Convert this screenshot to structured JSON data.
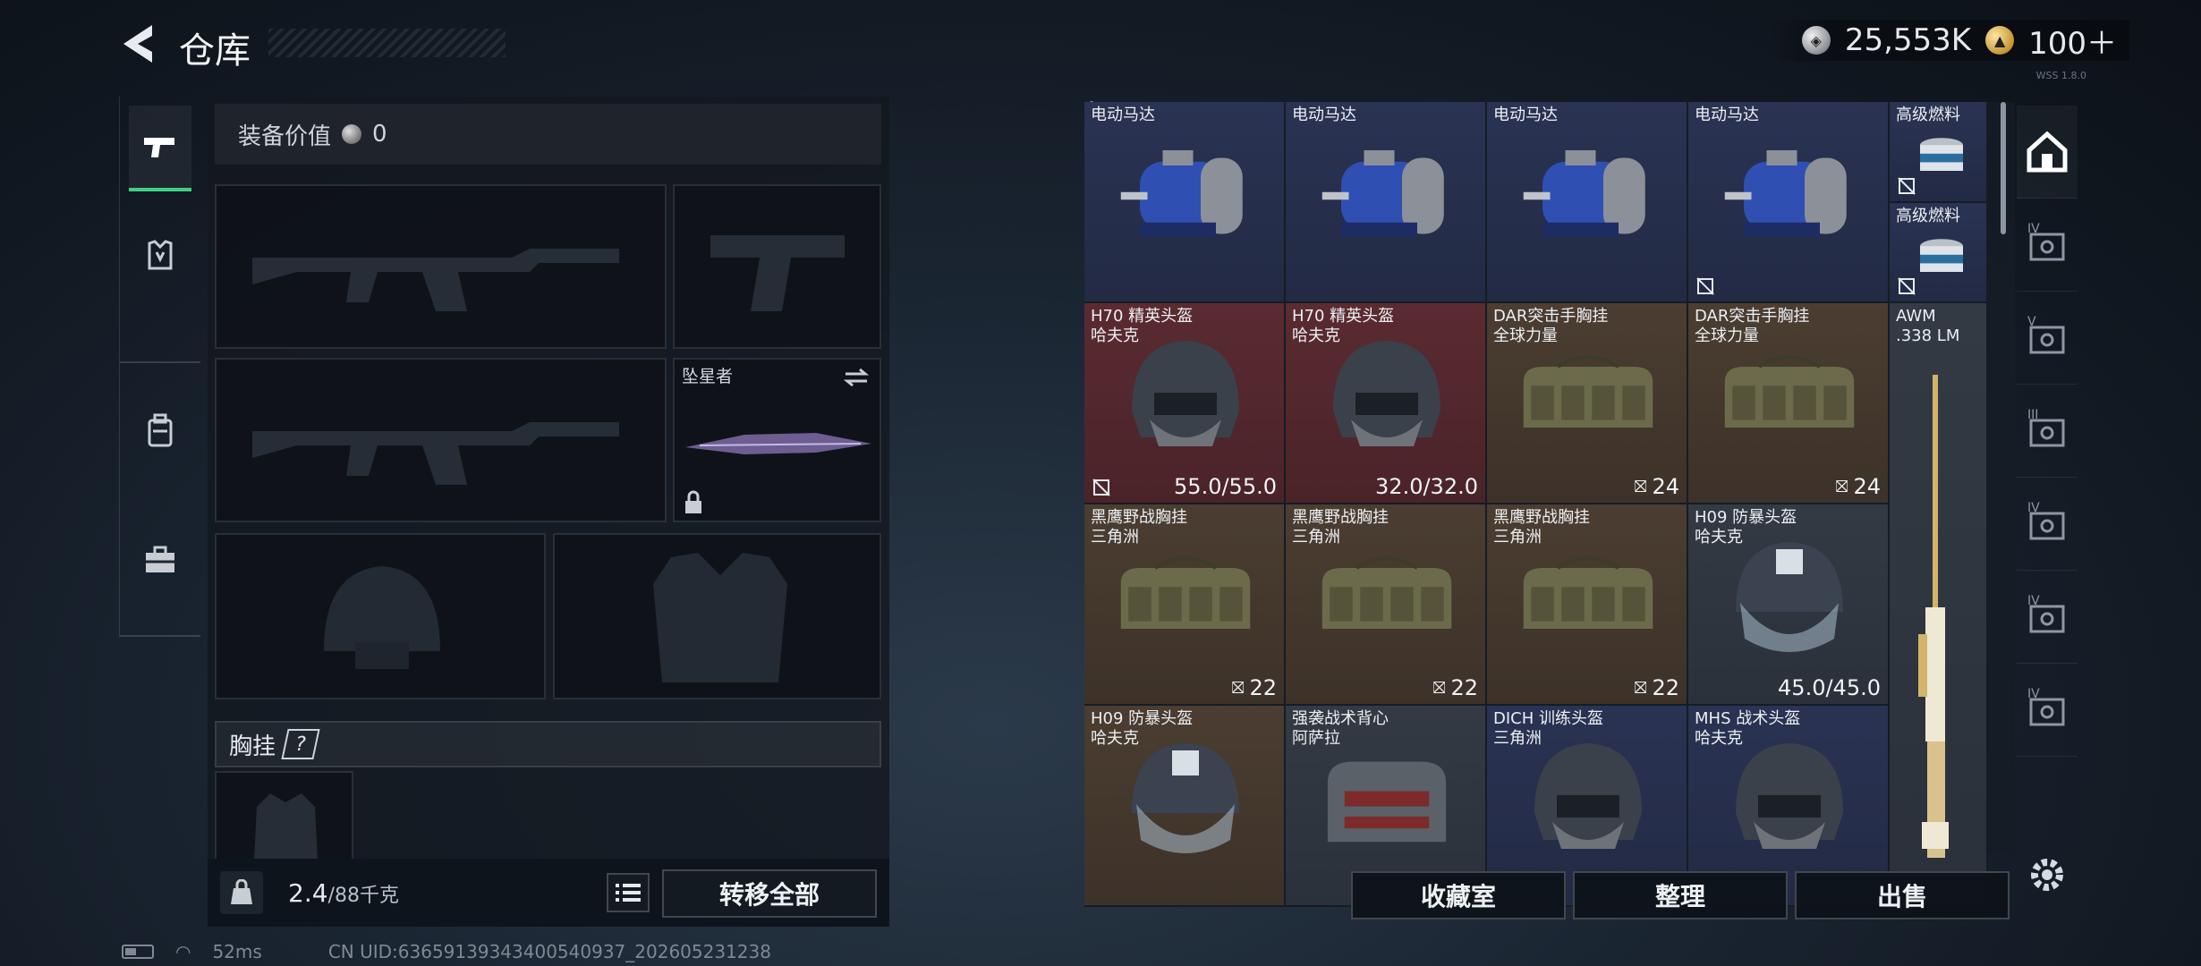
{
  "header": {
    "title": "仓库",
    "currency_silver": "25,553K",
    "currency_gold": "100＋",
    "corner_text": "WSS 1.8.0"
  },
  "equipment": {
    "value_label": "装备价值",
    "value": "0",
    "melee_name": "坠星者",
    "chest_rig_label": "胸挂",
    "help_symbol": "?",
    "weight": "2.4",
    "weight_max": "/88千克",
    "transfer_all": "转移全部"
  },
  "inventory": {
    "cells": [
      {
        "name": "电动马达",
        "sub": "",
        "value": "",
        "color": "blue",
        "icon": "electric-motor",
        "lock": false
      },
      {
        "name": "电动马达",
        "sub": "",
        "value": "",
        "color": "blue",
        "icon": "electric-motor",
        "lock": false
      },
      {
        "name": "电动马达",
        "sub": "",
        "value": "",
        "color": "blue",
        "icon": "electric-motor",
        "lock": false
      },
      {
        "name": "电动马达",
        "sub": "",
        "value": "",
        "color": "blue",
        "icon": "electric-motor",
        "lock": true
      },
      {
        "name": "高级燃料",
        "sub": "",
        "value": "",
        "color": "blue",
        "icon": "fuel-can",
        "lock": true
      },
      {
        "name": "高级燃料",
        "sub": "",
        "value": "",
        "color": "blue",
        "icon": "fuel-can",
        "lock": true
      },
      {
        "name": "H70 精英头盔",
        "sub": "哈夫克",
        "value": "55.0/55.0",
        "color": "red",
        "icon": "helmet",
        "lock": true
      },
      {
        "name": "H70 精英头盔",
        "sub": "哈夫克",
        "value": "32.0/32.0",
        "color": "red",
        "icon": "helmet",
        "lock": false
      },
      {
        "name": "DAR突击手胸挂",
        "sub": "全球力量",
        "value": "24",
        "color": "brown",
        "icon": "chest-rig",
        "lock": false
      },
      {
        "name": "DAR突击手胸挂",
        "sub": "全球力量",
        "value": "24",
        "color": "brown",
        "icon": "chest-rig",
        "lock": false
      },
      {
        "name": "AWM",
        "sub": ".338 LM",
        "value": "",
        "color": "gray",
        "icon": "sniper-rifle",
        "lock": false
      },
      {
        "name": "黑鹰野战胸挂",
        "sub": "三角洲",
        "value": "22",
        "color": "brown",
        "icon": "chest-rig",
        "lock": false
      },
      {
        "name": "黑鹰野战胸挂",
        "sub": "三角洲",
        "value": "22",
        "color": "brown",
        "icon": "chest-rig",
        "lock": false
      },
      {
        "name": "黑鹰野战胸挂",
        "sub": "三角洲",
        "value": "22",
        "color": "brown",
        "icon": "chest-rig",
        "lock": false
      },
      {
        "name": "H09 防暴头盔",
        "sub": "哈夫克",
        "value": "45.0/45.0",
        "color": "gray",
        "icon": "riot-helmet",
        "lock": false
      },
      {
        "name": "H09 防暴头盔",
        "sub": "哈夫克",
        "value": "",
        "color": "brown",
        "icon": "riot-helmet",
        "lock": false
      },
      {
        "name": "强袭战术背心",
        "sub": "阿萨拉",
        "value": "",
        "color": "gray",
        "icon": "vest",
        "lock": false
      },
      {
        "name": "DICH 训练头盔",
        "sub": "三角洲",
        "value": "",
        "color": "blue",
        "icon": "helmet",
        "lock": false
      },
      {
        "name": "MHS 战术头盔",
        "sub": "哈夫克",
        "value": "",
        "color": "blue",
        "icon": "helmet",
        "lock": false
      }
    ],
    "buttons": {
      "collection": "收藏室",
      "sort": "整理",
      "sell": "出售"
    }
  },
  "right_tabs": [
    "home",
    "IV",
    "V",
    "III",
    "IV",
    "IV",
    "IV"
  ],
  "status": {
    "ping": "52ms",
    "uid": "CN UID:63659139343400540937_202605231238"
  }
}
